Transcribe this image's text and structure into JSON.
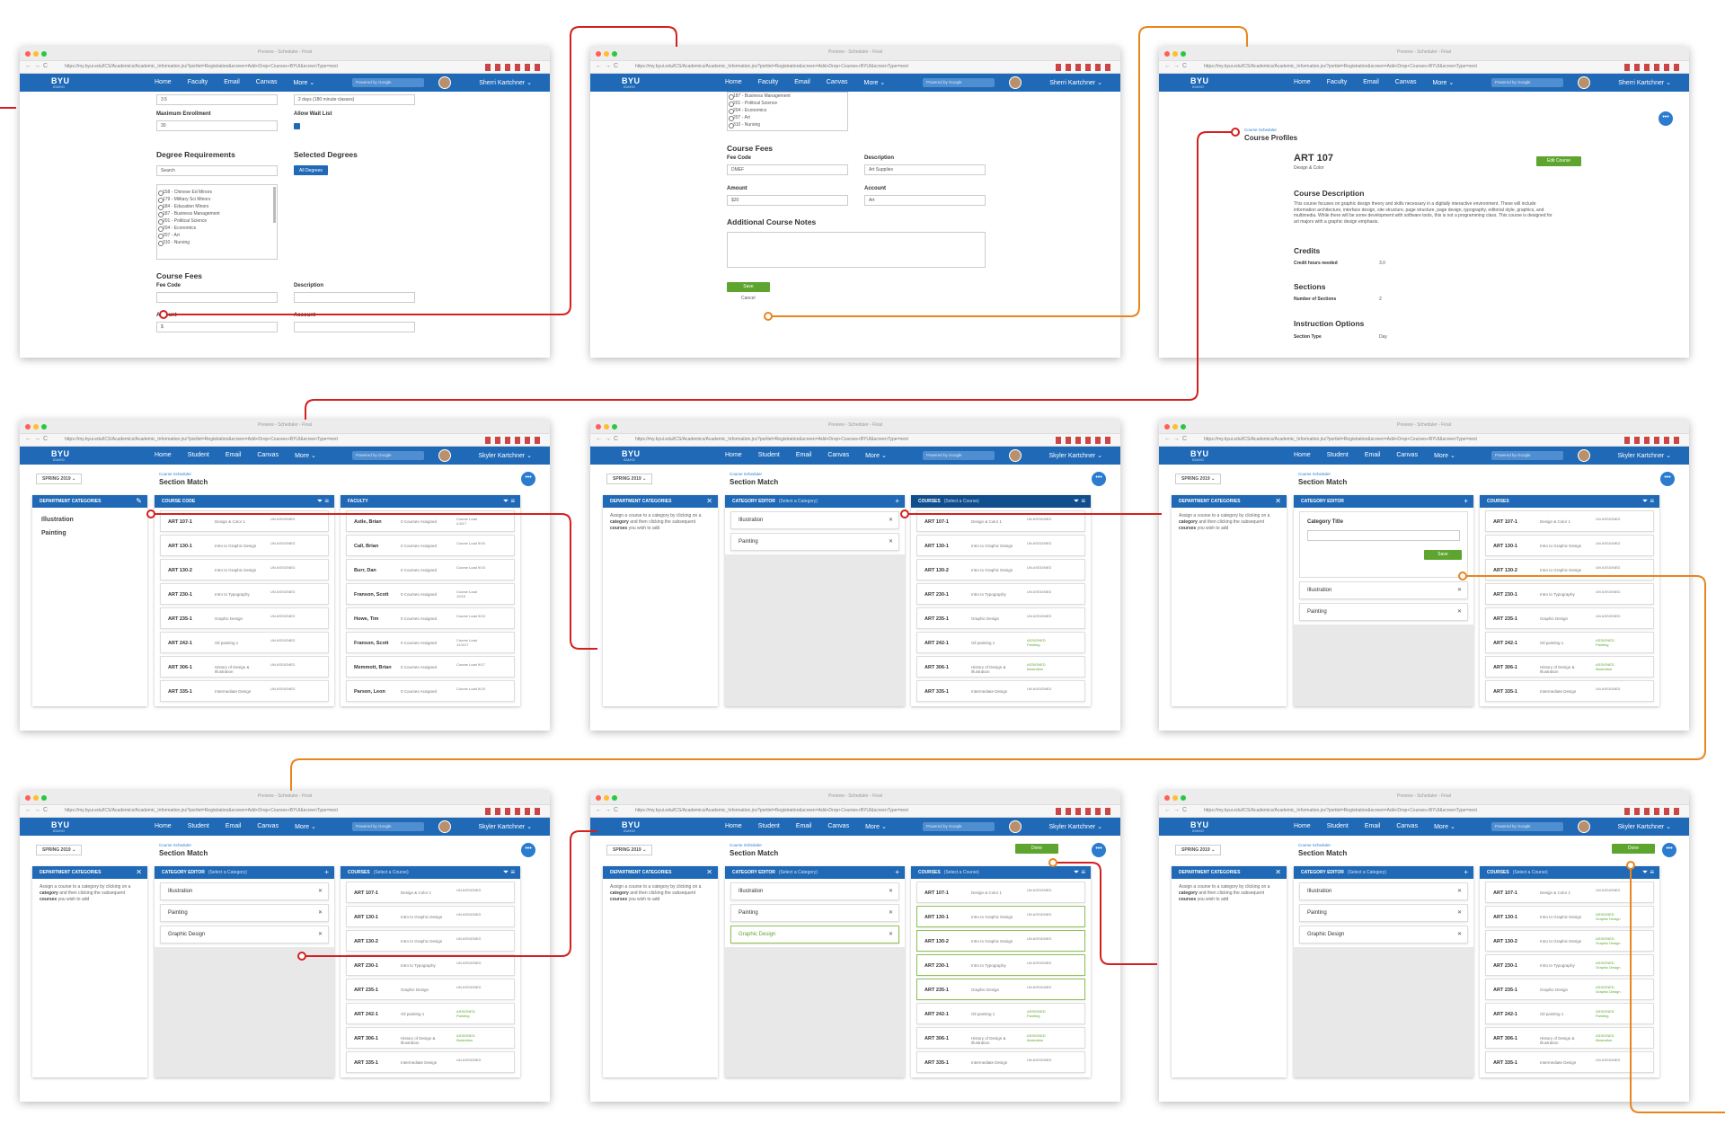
{
  "browser": {
    "window_title": "Preview - Scheduler - Final",
    "url": "https://my.byui.edu/ICS/Academics/Academic_Information.jnz?portlet=Registration&screen=Add+Drop+Courses+BYUI&screenType=next"
  },
  "nav": {
    "logo": "BYU",
    "logo_sub": "IDAHO",
    "links_faculty": [
      "Home",
      "Faculty",
      "Email",
      "Canvas",
      "More ⌄"
    ],
    "links_student": [
      "Home",
      "Student",
      "Email",
      "Canvas",
      "More ⌄"
    ],
    "search": "Powered by Google",
    "user_sherri": "Sherri Kartchner ⌄",
    "user_skyler": "Skyler Kartchner ⌄"
  },
  "s1": {
    "credit_value": "3.5",
    "meeting_value": "2 days (180 minute classes)",
    "max_enroll_label": "Maximum Enrollment",
    "max_enroll_value": "30",
    "waitlist_label": "Allow Wait List",
    "degree_req_title": "Degree Requirements",
    "selected_deg_title": "Selected Degrees",
    "search_placeholder": "Search",
    "all_degrees": "All Degrees",
    "degrees": [
      "158 - Chinese Ed Minors",
      "179 - Military Sci Minors",
      "184 - Education Minors",
      "187 - Business Management",
      "201 - Political Science",
      "204 - Economics",
      "207 - Art",
      "310 - Nursing"
    ],
    "fees_title": "Course Fees",
    "fee_code_label": "Fee Code",
    "description_label": "Description",
    "amount_label": "Amount",
    "account_label": "Account",
    "amount_value": "$"
  },
  "s2": {
    "degrees": [
      "187 - Business Management",
      "201 - Political Science",
      "204 - Economics",
      "207 - Art",
      "310 - Nursing"
    ],
    "fees_title": "Course Fees",
    "fee_code_label": "Fee Code",
    "fee_code_value": "DMEF",
    "description_label": "Description",
    "description_value": "Art Supplies",
    "amount_label": "Amount",
    "amount_value": "$20",
    "account_label": "Account",
    "account_value": "Art",
    "notes_title": "Additional Course Notes",
    "save": "Save",
    "cancel": "Cancel"
  },
  "s3": {
    "crumb": "Course Scheduler",
    "title": "Course Profiles",
    "course": "ART 107",
    "course_sub": "Design & Color",
    "edit": "Edit Course",
    "desc_title": "Course Description",
    "desc": "This course focuses on graphic design theory and skills necessary in a digitally interactive environment. These will include information architecture, interface design, site structure, page structure, page design, typography, editorial style, graphics, and multimedia. While there will be some development with software tools, this is not a programming class. This course is designed for art majors with a graphic design emphasis.",
    "credits_title": "Credits",
    "credit_hours_label": "Credit hours needed",
    "credit_hours_value": "3.0",
    "sections_title": "Sections",
    "num_sections_label": "Number of Sections",
    "num_sections_value": "2",
    "instr_title": "Instruction Options",
    "section_type_label": "Section Type",
    "section_type_value": "Day"
  },
  "match": {
    "semester": "SPRING 2019 ⌄",
    "crumb": "Course Scheduler",
    "title": "Section Match",
    "dept_categories": "DEPARTMENT CATEGORIES",
    "category_editor": "CATEGORY EDITOR",
    "select_category": "(Select a Category)",
    "courses": "COURSES",
    "select_course": "(Select a Course)",
    "course_code": "COURSE CODE",
    "faculty": "FACULTY",
    "hint_pre": "Assign a course to a category by clicking on a ",
    "hint_b1": "category",
    "hint_mid": " and then clicking the subsequent ",
    "hint_b2": "courses",
    "hint_post": " you wish to add",
    "category_title_label": "Category Title",
    "save": "Save",
    "done": "Done",
    "categories": [
      "Illustration",
      "Painting"
    ],
    "graphic": "Graphic Design",
    "unassigned": "UN ASSIGNED",
    "assigned_painting": "ASSIGNED Painting",
    "assigned_illustration": "ASSIGNED Illustration",
    "assigned_graphic": "ASSIGNED Graphic Design"
  },
  "courses": [
    {
      "code": "ART 107-1",
      "name": "Design & Color 1"
    },
    {
      "code": "ART 130-1",
      "name": "Intro to Graphic Design"
    },
    {
      "code": "ART 130-2",
      "name": "Intro to Graphic Design"
    },
    {
      "code": "ART 230-1",
      "name": "Intro to Typography"
    },
    {
      "code": "ART 235-1",
      "name": "Graphic Design"
    },
    {
      "code": "ART 242-1",
      "name": "Oil painting 1"
    },
    {
      "code": "ART 306-1",
      "name": "History of Design & Illustration"
    },
    {
      "code": "ART 335-1",
      "name": "Intermediate Design"
    }
  ],
  "faculty": [
    {
      "name": "Astle, Brian",
      "assigned": "0 Courses Assigned",
      "load": "Course Load 4.5/17"
    },
    {
      "name": "Call, Brian",
      "assigned": "0 Courses Assigned",
      "load": "Course Load 9/15"
    },
    {
      "name": "Burr, Dan",
      "assigned": "0 Courses Assigned",
      "load": "Course Load 9/15"
    },
    {
      "name": "Franson, Scott",
      "assigned": "0 Courses Assigned",
      "load": "Course Load 12/15"
    },
    {
      "name": "Howe, Tim",
      "assigned": "0 Courses Assigned",
      "load": "Course Load 9/15"
    },
    {
      "name": "Franson, Scott",
      "assigned": "0 Courses Assigned",
      "load": "Course Load 13.5/17"
    },
    {
      "name": "Memmott, Brian",
      "assigned": "0 Courses Assigned",
      "load": "Course Load 9/17"
    },
    {
      "name": "Parson, Leon",
      "assigned": "0 Courses Assigned",
      "load": "Course Load 9/15"
    }
  ],
  "colors": {
    "blue": "#1f69b7",
    "green": "#5ea52f",
    "red_flow": "#d42020",
    "orange_flow": "#e8861e"
  }
}
